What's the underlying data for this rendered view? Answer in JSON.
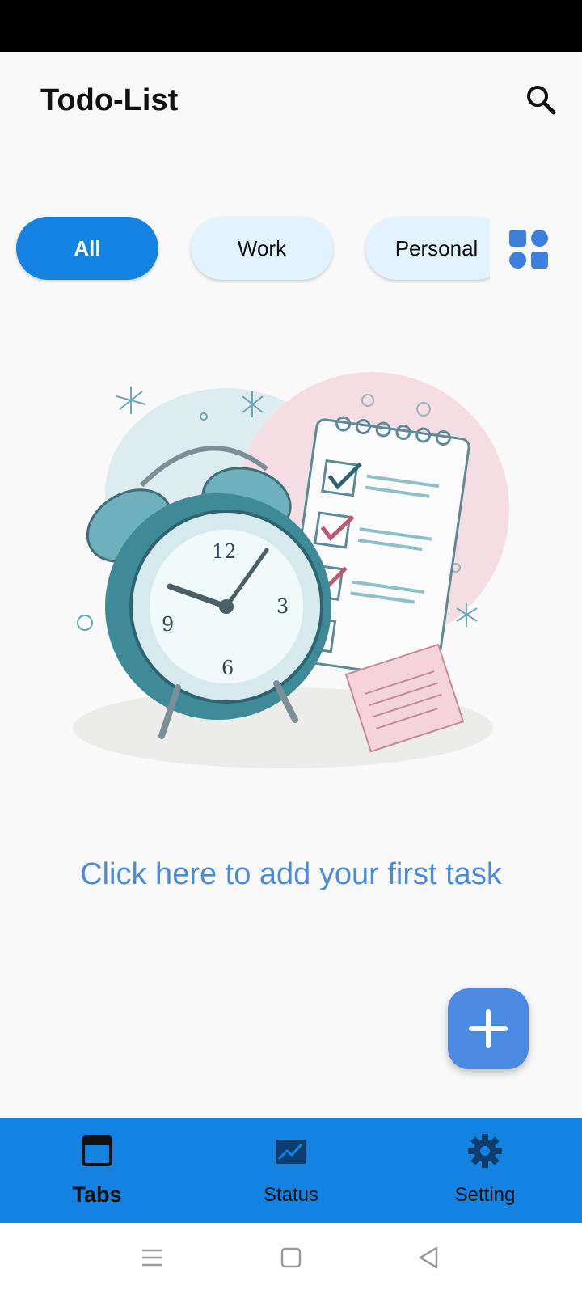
{
  "app": {
    "title": "Todo-List"
  },
  "header": {
    "search_icon": "search-icon"
  },
  "filters": {
    "chips": [
      {
        "label": "All",
        "selected": true
      },
      {
        "label": "Work",
        "selected": false
      },
      {
        "label": "Personal",
        "selected": false
      }
    ],
    "grid_icon": "category-grid-icon"
  },
  "empty_state": {
    "illustration": "alarm-clock-calendar-illustration",
    "prompt": "Click here to add your first task"
  },
  "fab": {
    "icon": "plus-icon"
  },
  "bottom_nav": {
    "items": [
      {
        "label": "Tabs",
        "icon": "tab-window-icon",
        "active": true
      },
      {
        "label": "Status",
        "icon": "chart-icon",
        "active": false
      },
      {
        "label": "Setting",
        "icon": "gear-icon",
        "active": false
      }
    ]
  },
  "colors": {
    "accent": "#1382e0",
    "chip_inactive": "#e3f3fd",
    "fab": "#4b8ae3",
    "prompt_text": "#4a8ad8",
    "background": "#f9f9f9"
  }
}
